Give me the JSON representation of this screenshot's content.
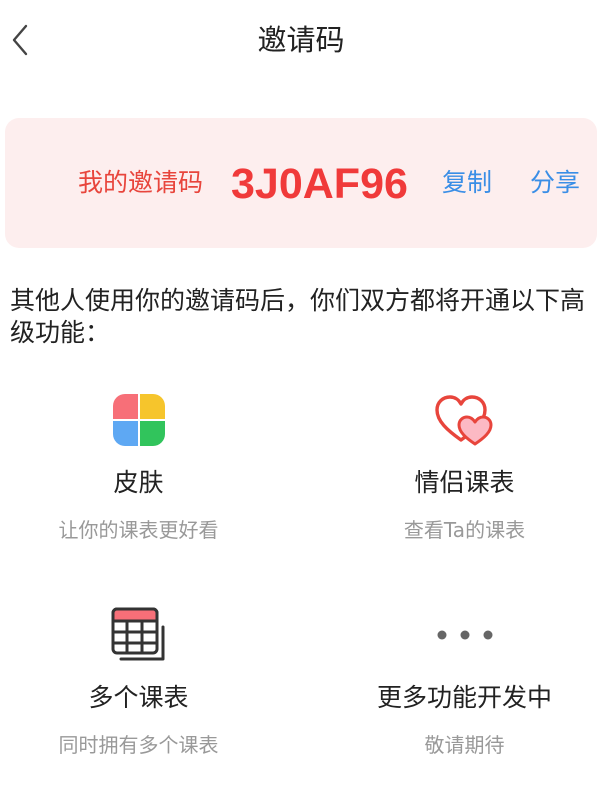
{
  "header": {
    "title": "邀请码"
  },
  "invite": {
    "label": "我的邀请码",
    "code": "3J0AF96",
    "copy_label": "复制",
    "share_label": "分享"
  },
  "description": "其他人使用你的邀请码后，你们双方都将开通以下高级功能：",
  "features": [
    {
      "title": "皮肤",
      "subtitle": "让你的课表更好看",
      "icon": "clover-icon"
    },
    {
      "title": "情侣课表",
      "subtitle": "查看Ta的课表",
      "icon": "hearts-icon"
    },
    {
      "title": "多个课表",
      "subtitle": "同时拥有多个课表",
      "icon": "timetable-icon"
    },
    {
      "title": "更多功能开发中",
      "subtitle": "敬请期待",
      "icon": "more-dots-icon"
    }
  ],
  "colors": {
    "accent_red": "#f03a3a",
    "label_red": "#e8453c",
    "link_blue": "#3a8ee6",
    "card_bg": "#fdeeee",
    "subtle_gray": "#999999"
  }
}
